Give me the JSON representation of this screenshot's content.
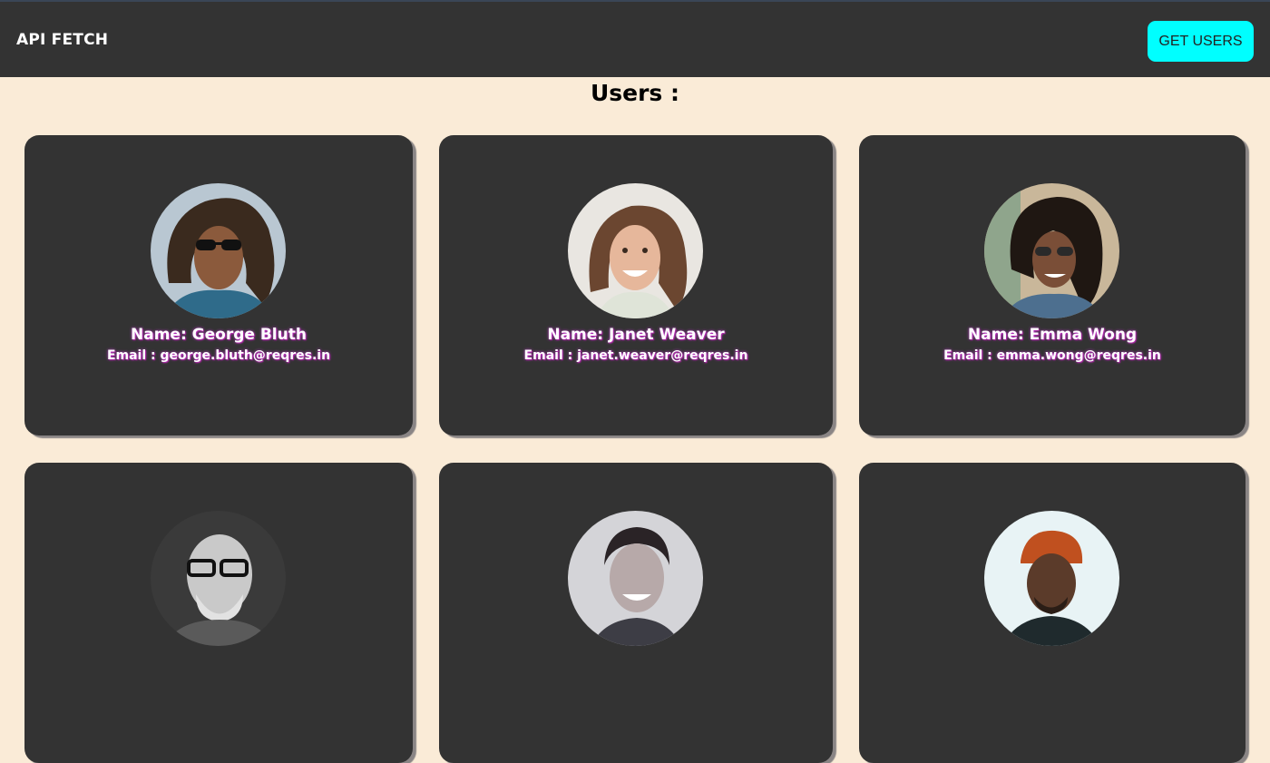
{
  "navbar": {
    "brand": "API FETCH",
    "button_label": "GET USERS"
  },
  "heading": "Users :",
  "users": [
    {
      "name": "Name: George Bluth",
      "email": "Email : george.bluth@reqres.in"
    },
    {
      "name": "Name: Janet Weaver",
      "email": "Email : janet.weaver@reqres.in"
    },
    {
      "name": "Name: Emma Wong",
      "email": "Email : emma.wong@reqres.in"
    },
    {
      "name": "",
      "email": ""
    },
    {
      "name": "",
      "email": ""
    },
    {
      "name": "",
      "email": ""
    }
  ],
  "colors": {
    "navbar_bg": "#333333",
    "page_bg": "#faebd7",
    "button_bg": "#00ffff",
    "card_bg": "#333333"
  }
}
